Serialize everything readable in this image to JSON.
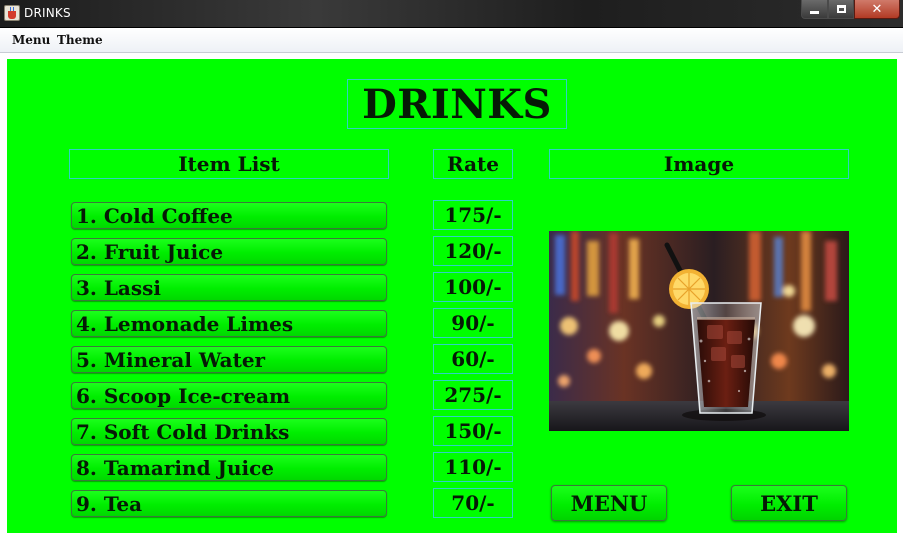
{
  "window": {
    "title": "DRINKS",
    "controls": {
      "close_label": "✕"
    }
  },
  "menubar": {
    "items": [
      {
        "label": "Menu"
      },
      {
        "label": "Theme"
      }
    ]
  },
  "page": {
    "heading": "DRINKS",
    "columns": {
      "items": "Item List",
      "rate": "Rate",
      "image": "Image"
    },
    "drinks": [
      {
        "name": "1. Cold Coffee",
        "rate": "175/-"
      },
      {
        "name": "2. Fruit Juice",
        "rate": "120/-"
      },
      {
        "name": "3. Lassi",
        "rate": "100/-"
      },
      {
        "name": "4. Lemonade Limes",
        "rate": "90/-"
      },
      {
        "name": "5. Mineral Water",
        "rate": "60/-"
      },
      {
        "name": "6. Scoop Ice-cream",
        "rate": "275/-"
      },
      {
        "name": "7. Soft Cold Drinks",
        "rate": "150/-"
      },
      {
        "name": "8. Tamarind Juice",
        "rate": "110/-"
      },
      {
        "name": "9. Tea",
        "rate": "70/-"
      }
    ],
    "buttons": {
      "menu": "MENU",
      "exit": "EXIT"
    }
  },
  "colors": {
    "background": "#00ff00",
    "cell_border": "#2ed2c7",
    "text": "#061a06"
  },
  "icons": {
    "app": "java-cup-icon",
    "minimize": "minimize-icon",
    "maximize": "maximize-icon",
    "close": "close-icon"
  }
}
